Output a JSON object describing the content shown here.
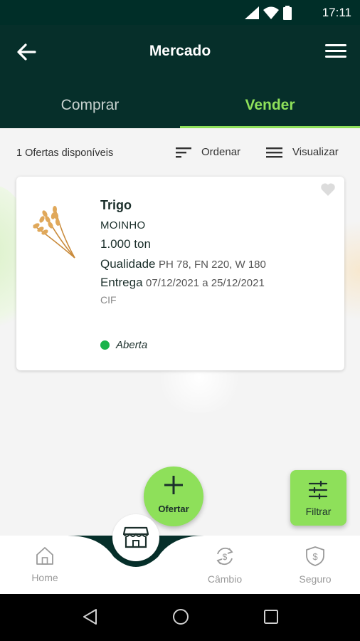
{
  "status_bar": {
    "time": "17:11"
  },
  "app_bar": {
    "title": "Mercado"
  },
  "tabs": [
    {
      "label": "Comprar",
      "active": false
    },
    {
      "label": "Vender",
      "active": true
    }
  ],
  "toolbar": {
    "offers_count": "1 Ofertas  disponíveis",
    "sort_label": "Ordenar",
    "view_label": "Visualizar"
  },
  "offer_card": {
    "product": "Trigo",
    "origin": "MOINHO",
    "quantity": "1.000 ton",
    "quality_label": "Qualidade",
    "quality_value": "PH 78, FN 220, W 180",
    "delivery_label": "Entrega",
    "delivery_value": "07/12/2021 a 25/12/2021",
    "freight": "CIF",
    "status": "Aberta",
    "status_color": "#19b34a",
    "favorite": false
  },
  "fab_offer": {
    "label": "Ofertar"
  },
  "fab_filter": {
    "label": "Filtrar"
  },
  "bottom_nav": {
    "items": [
      {
        "label": "Home",
        "icon": "home-icon"
      },
      {
        "label": "",
        "icon": "market-icon",
        "active": true
      },
      {
        "label": "Câmbio",
        "icon": "exchange-icon"
      },
      {
        "label": "Seguro",
        "icon": "shield-dollar-icon"
      }
    ]
  },
  "colors": {
    "primary_dark": "#062f2a",
    "accent_green": "#8ee05a",
    "status_green": "#19b34a"
  }
}
